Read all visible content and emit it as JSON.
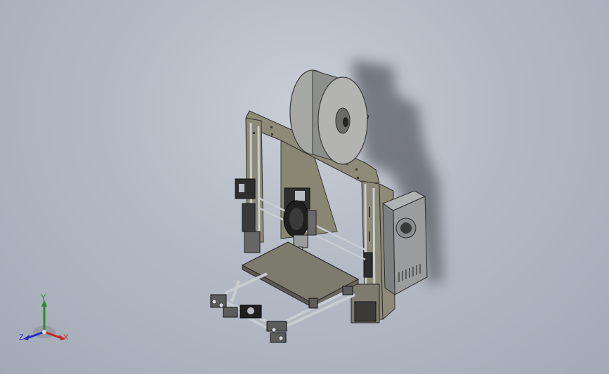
{
  "viewport": {
    "background_top": "#c8cdd6",
    "background_bottom": "#a3aab7"
  },
  "model": {
    "frame_color": "#8e8a78",
    "metal_color": "#b9bcc1",
    "dark_color": "#2e2e2e",
    "bed_color": "#7d7a6e",
    "psu_color": "#9a9c9e"
  },
  "triad": {
    "x_label": "X",
    "y_label": "Y",
    "z_label": "Z",
    "x_color": "#c0282a",
    "y_color": "#2a8a2a",
    "z_color": "#2a2ac0"
  }
}
